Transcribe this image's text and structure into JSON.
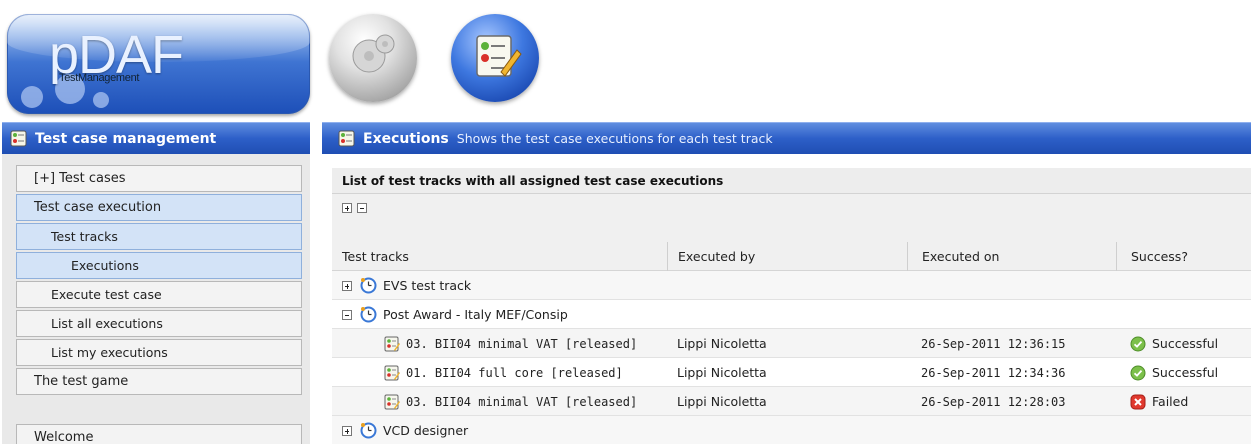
{
  "logo": {
    "title": "pDAF",
    "subtitle": "TestManagement"
  },
  "header_buttons": [
    {
      "name": "settings",
      "icon": "gears-icon"
    },
    {
      "name": "test-management",
      "icon": "checklist-icon"
    }
  ],
  "sidebar": {
    "title": "Test case management",
    "items": [
      {
        "label": "[+] Test cases",
        "level": 0,
        "selected": false
      },
      {
        "label": "Test case execution",
        "level": 0,
        "selected": true
      },
      {
        "label": "Test tracks",
        "level": 1,
        "selected": true
      },
      {
        "label": "Executions",
        "level": 2,
        "selected": true
      },
      {
        "label": "Execute test case",
        "level": 1,
        "selected": false
      },
      {
        "label": "List all executions",
        "level": 1,
        "selected": false
      },
      {
        "label": "List my executions",
        "level": 1,
        "selected": false
      },
      {
        "label": "The test game",
        "level": 0,
        "selected": false
      },
      {
        "label": "Welcome",
        "level": 0,
        "selected": false
      }
    ]
  },
  "main": {
    "title": "Executions",
    "description": "Shows the test case executions for each test track",
    "caption": "List of test tracks with all assigned test case executions",
    "columns": [
      "Test tracks",
      "Executed by",
      "Executed on",
      "Success?"
    ],
    "rows": [
      {
        "type": "group",
        "label": "EVS test track",
        "expanded": false
      },
      {
        "type": "group",
        "label": "Post Award - Italy MEF/Consip",
        "expanded": true
      },
      {
        "type": "item",
        "label": "03. BII04 minimal VAT [released]",
        "by": "Lippi Nicoletta",
        "on": "26-Sep-2011 12:36:15",
        "status": "Successful"
      },
      {
        "type": "item",
        "label": "01. BII04 full core [released]",
        "by": "Lippi Nicoletta",
        "on": "26-Sep-2011 12:34:36",
        "status": "Successful"
      },
      {
        "type": "item",
        "label": "03. BII04 minimal VAT [released]",
        "by": "Lippi Nicoletta",
        "on": "26-Sep-2011 12:28:03",
        "status": "Failed"
      },
      {
        "type": "group",
        "label": "VCD designer",
        "expanded": false
      }
    ]
  },
  "colors": {
    "header_blue": "#2d5fc8",
    "success": "#6ab03a",
    "failed": "#d9302a"
  }
}
